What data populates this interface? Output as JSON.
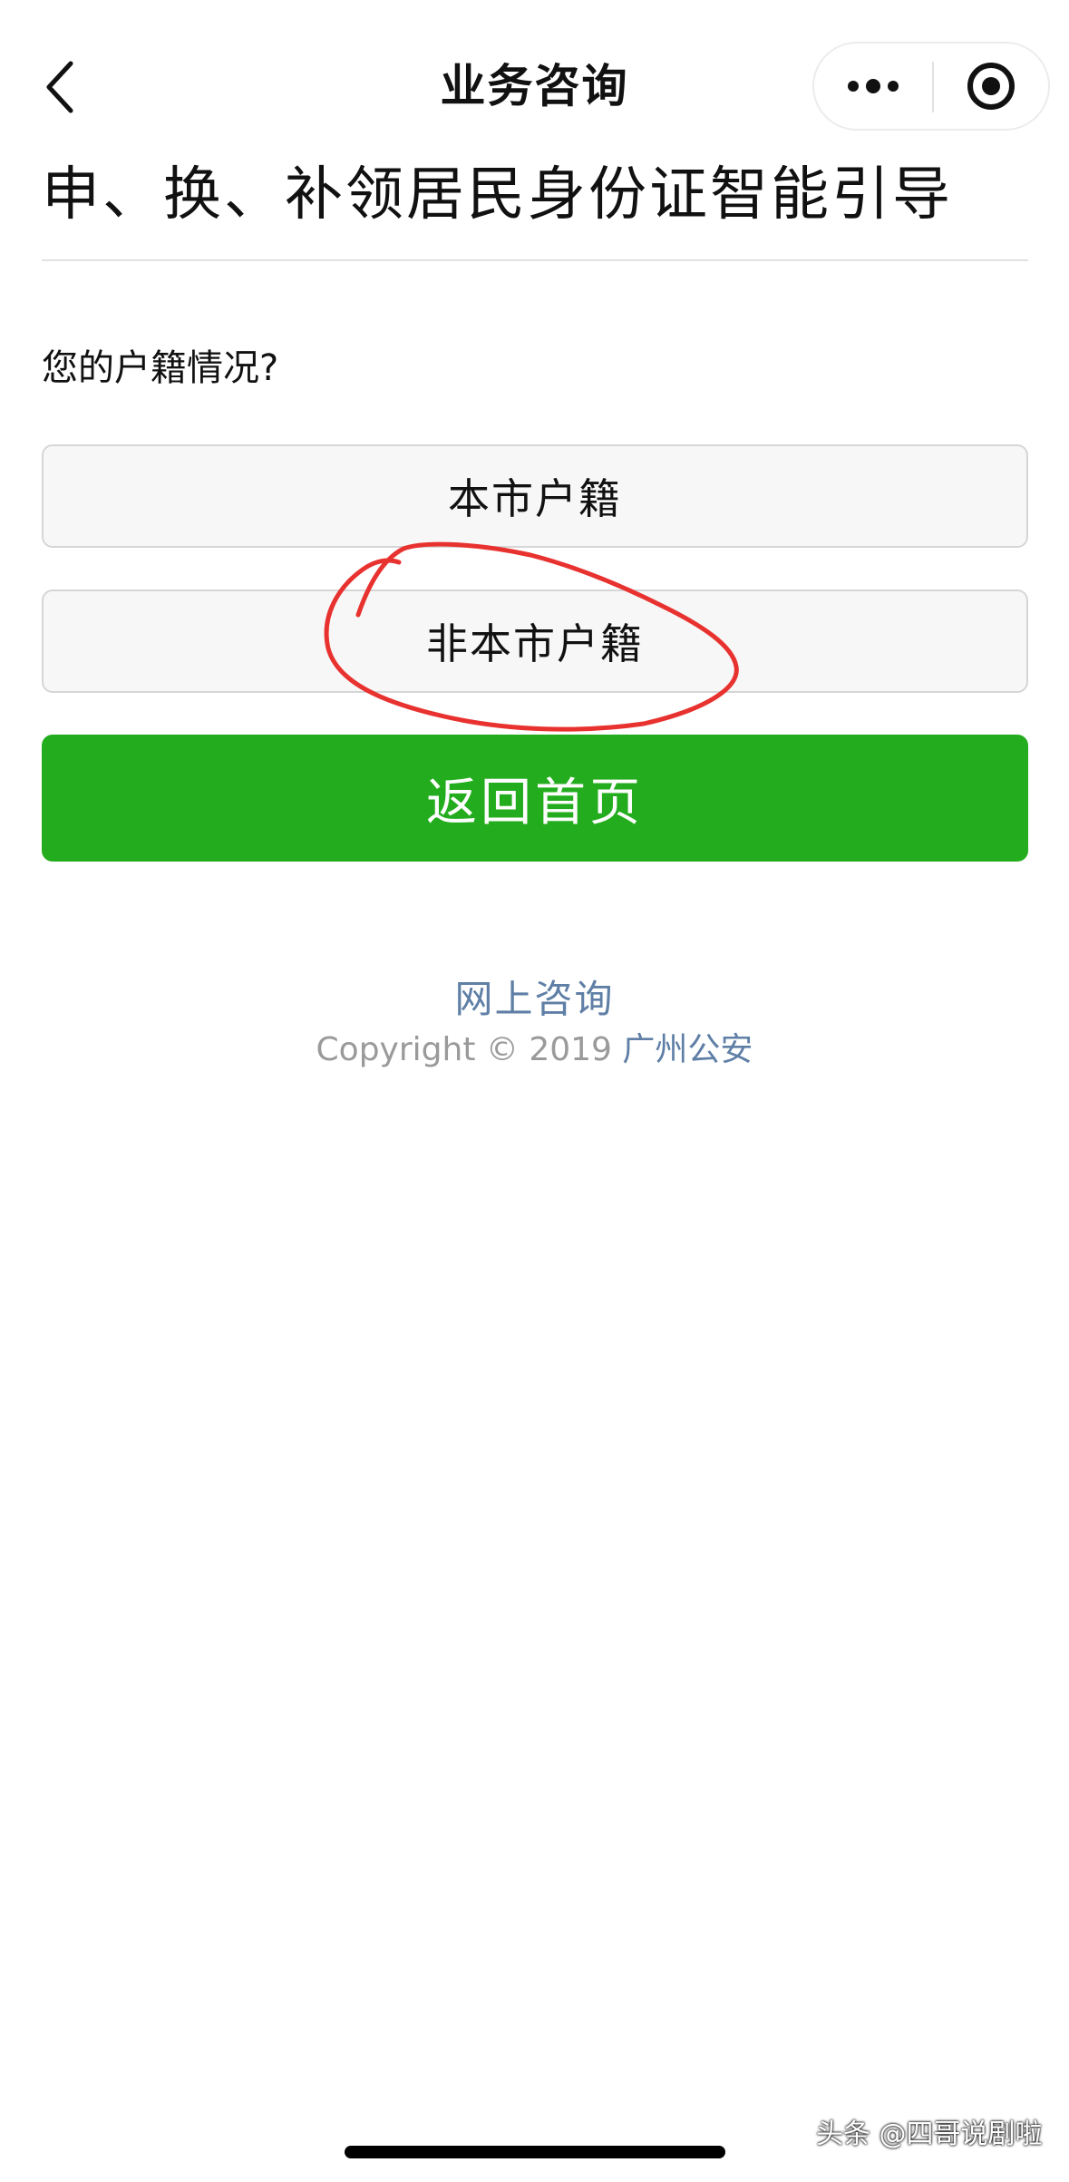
{
  "nav": {
    "title": "业务咨询",
    "back_icon": "chevron-left-icon",
    "more_icon": "more-dots-icon",
    "close_icon": "target-close-icon"
  },
  "content": {
    "heading": "申、换、补领居民身份证智能引导",
    "question": "您的户籍情况?",
    "options": [
      {
        "label": "本市户籍"
      },
      {
        "label": "非本市户籍"
      }
    ],
    "home_button": "返回首页",
    "annotation_color": "#e8322f"
  },
  "footer": {
    "link": "网上咨询",
    "copyright_prefix": "Copyright © 2019",
    "organization": "广州公安"
  },
  "watermark": "头条 @四哥说剧啦",
  "colors": {
    "primary_green": "#23ad1e",
    "link_blue": "#5f7fa6",
    "option_bg": "#f7f7f7"
  }
}
